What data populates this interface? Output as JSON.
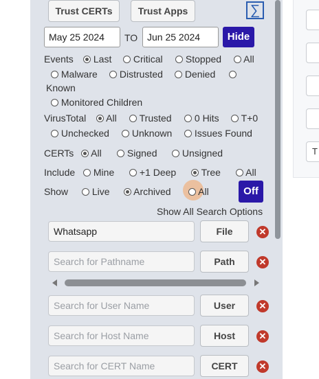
{
  "toolbar": {
    "trust_certs": "Trust CERTs",
    "trust_apps": "Trust Apps",
    "sigma": "∑"
  },
  "dates": {
    "from": "May 25 2024",
    "to_label": "TO",
    "to": "Jun 25 2024",
    "hide": "Hide"
  },
  "events": {
    "label": "Events",
    "options": [
      "Last",
      "Critical",
      "Stopped",
      "All",
      "Malware",
      "Distrusted",
      "Denied",
      "Known",
      "Monitored Children"
    ],
    "selected": "Last"
  },
  "virustotal": {
    "label": "VirusTotal",
    "options": [
      "All",
      "Trusted",
      "0 Hits",
      "T+0",
      "Unchecked",
      "Unknown",
      "Issues Found"
    ],
    "selected": "All"
  },
  "certs": {
    "label": "CERTs",
    "options": [
      "All",
      "Signed",
      "Unsigned"
    ],
    "selected": "All"
  },
  "include": {
    "label": "Include",
    "options": [
      "Mine",
      "+1 Deep",
      "Tree",
      "All"
    ],
    "selected": "Tree"
  },
  "show": {
    "label": "Show",
    "options": [
      "Live",
      "Archived",
      "All"
    ],
    "selected": "Archived",
    "off": "Off"
  },
  "show_all_link": "Show All Search Options",
  "searches": [
    {
      "value": "Whatsapp",
      "placeholder": "",
      "button": "File"
    },
    {
      "value": "",
      "placeholder": "Search for Pathname",
      "button": "Path"
    },
    {
      "value": "",
      "placeholder": "Search for User Name",
      "button": "User"
    },
    {
      "value": "",
      "placeholder": "Search for Host Name",
      "button": "Host"
    },
    {
      "value": "",
      "placeholder": "Search for CERT Name",
      "button": "CERT"
    }
  ],
  "remove_icon": "✕",
  "right_panel": {
    "last_button_fragment": "T"
  },
  "colors": {
    "accent": "#2a18a8",
    "remove": "#c0392b",
    "panel": "#dfe3ea"
  }
}
